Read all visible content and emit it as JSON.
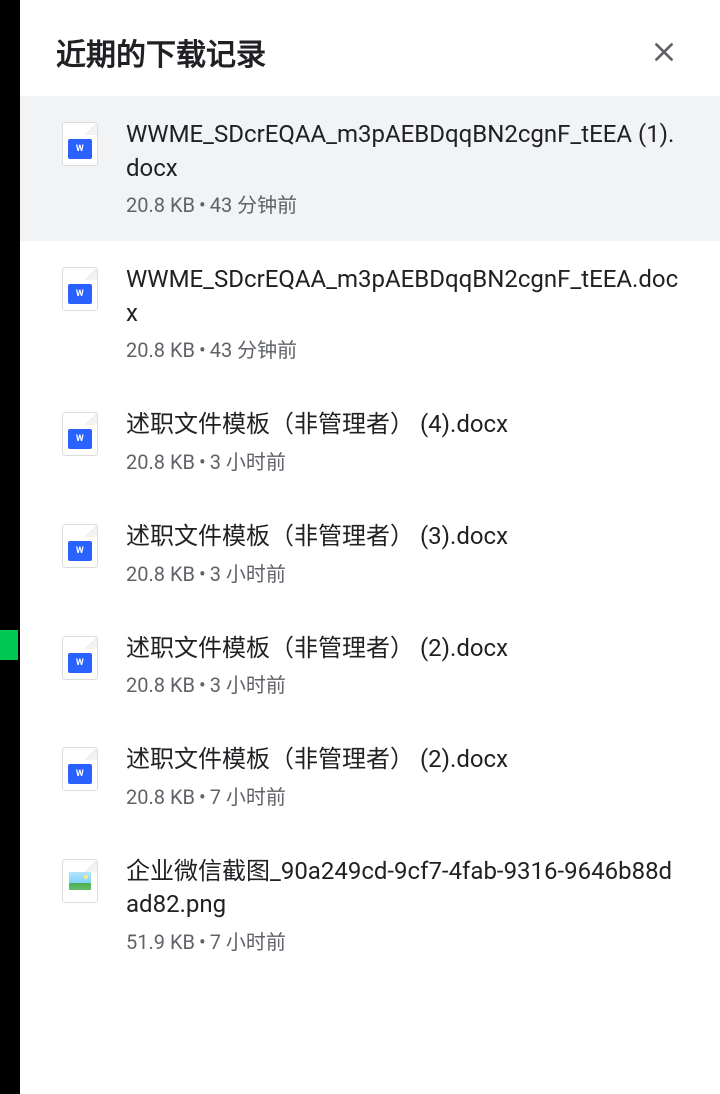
{
  "header": {
    "title": "近期的下载记录"
  },
  "downloads": [
    {
      "name": "WWME_SDcrEQAA_m3pAEBDqqBN2cgnF_tEEA (1).docx",
      "size": "20.8 KB",
      "time": "43 分钟前",
      "icon": "docx",
      "hover": true
    },
    {
      "name": "WWME_SDcrEQAA_m3pAEBDqqBN2cgnF_tEEA.docx",
      "size": "20.8 KB",
      "time": "43 分钟前",
      "icon": "docx",
      "hover": false
    },
    {
      "name": "述职文件模板（非管理者） (4).docx",
      "size": "20.8 KB",
      "time": "3 小时前",
      "icon": "docx",
      "hover": false
    },
    {
      "name": "述职文件模板（非管理者） (3).docx",
      "size": "20.8 KB",
      "time": "3 小时前",
      "icon": "docx",
      "hover": false
    },
    {
      "name": "述职文件模板（非管理者） (2).docx",
      "size": "20.8 KB",
      "time": "3 小时前",
      "icon": "docx",
      "hover": false
    },
    {
      "name": "述职文件模板（非管理者） (2).docx",
      "size": "20.8 KB",
      "time": "7 小时前",
      "icon": "docx",
      "hover": false
    },
    {
      "name": "企业微信截图_90a249cd-9cf7-4fab-9316-9646b88dad82.png",
      "size": "51.9 KB",
      "time": "7 小时前",
      "icon": "png",
      "hover": false
    }
  ]
}
